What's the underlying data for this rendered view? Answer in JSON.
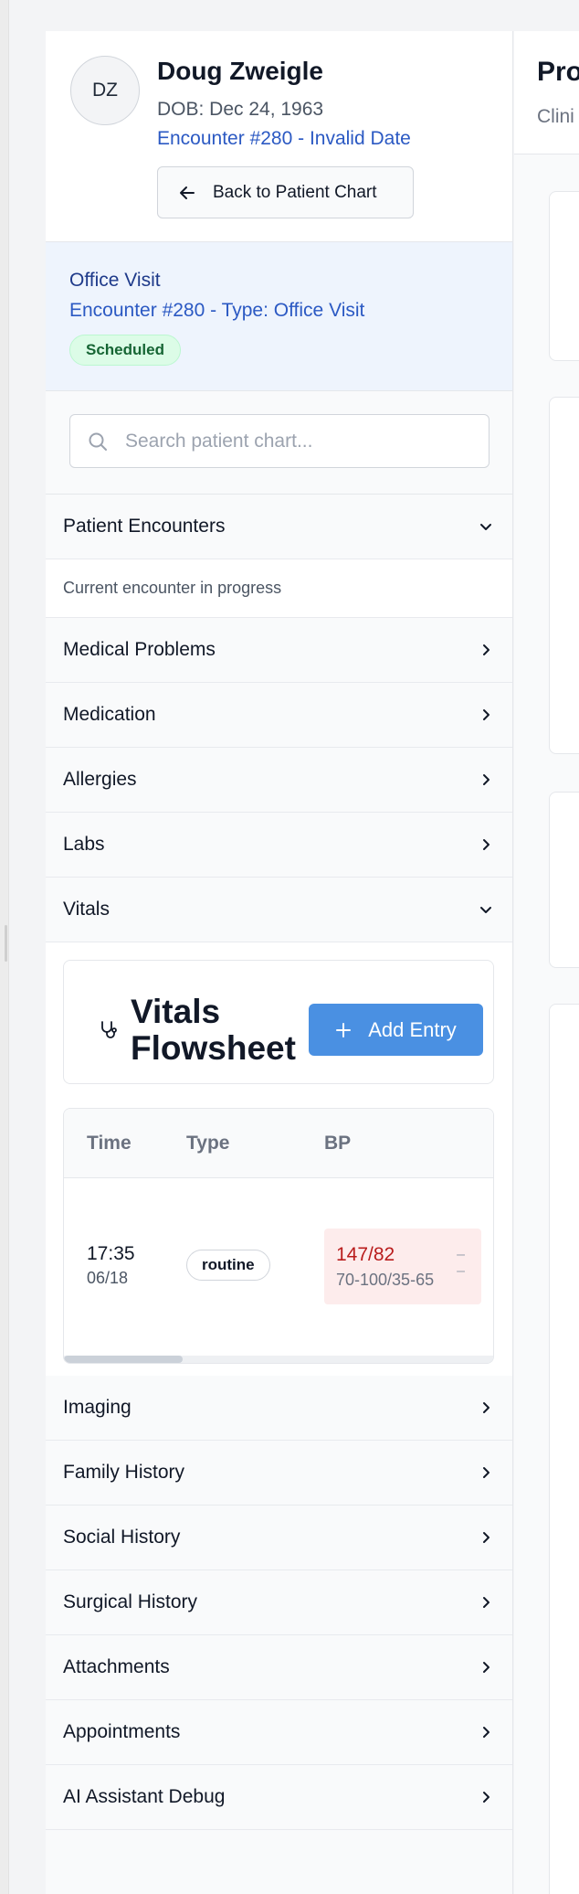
{
  "patient": {
    "initials": "DZ",
    "name": "Doug Zweigle",
    "dob": "DOB: Dec 24, 1963",
    "encounter": "Encounter #280 - Invalid Date",
    "back_button": "Back to Patient Chart"
  },
  "encounter_box": {
    "title": "Office Visit",
    "subtitle": "Encounter #280 - Type: Office Visit",
    "status": "Scheduled"
  },
  "search": {
    "placeholder": "Search patient chart..."
  },
  "nav": {
    "patient_encounters": "Patient Encounters",
    "current_encounter_note": "Current encounter in progress",
    "medical_problems": "Medical Problems",
    "medication": "Medication",
    "allergies": "Allergies",
    "labs": "Labs",
    "vitals": "Vitals",
    "imaging": "Imaging",
    "family_history": "Family History",
    "social_history": "Social History",
    "surgical_history": "Surgical History",
    "attachments": "Attachments",
    "appointments": "Appointments",
    "ai_assistant_debug": "AI Assistant Debug"
  },
  "vitals": {
    "title_line1": "Vitals",
    "title_line2": "Flowsheet",
    "add_button": "Add Entry",
    "columns": {
      "time": "Time",
      "type": "Type",
      "bp": "BP"
    },
    "rows": [
      {
        "time": "17:35",
        "date": "06/18",
        "type": "routine",
        "bp": "147/82",
        "bp_range": "70-100/35-65"
      }
    ]
  },
  "main": {
    "title": "Pro",
    "subtitle": "Clini"
  },
  "colors": {
    "accent": "#4a90e2",
    "link": "#2b59c3",
    "alert_bg": "#fdecec",
    "alert_text": "#b91c1c"
  }
}
